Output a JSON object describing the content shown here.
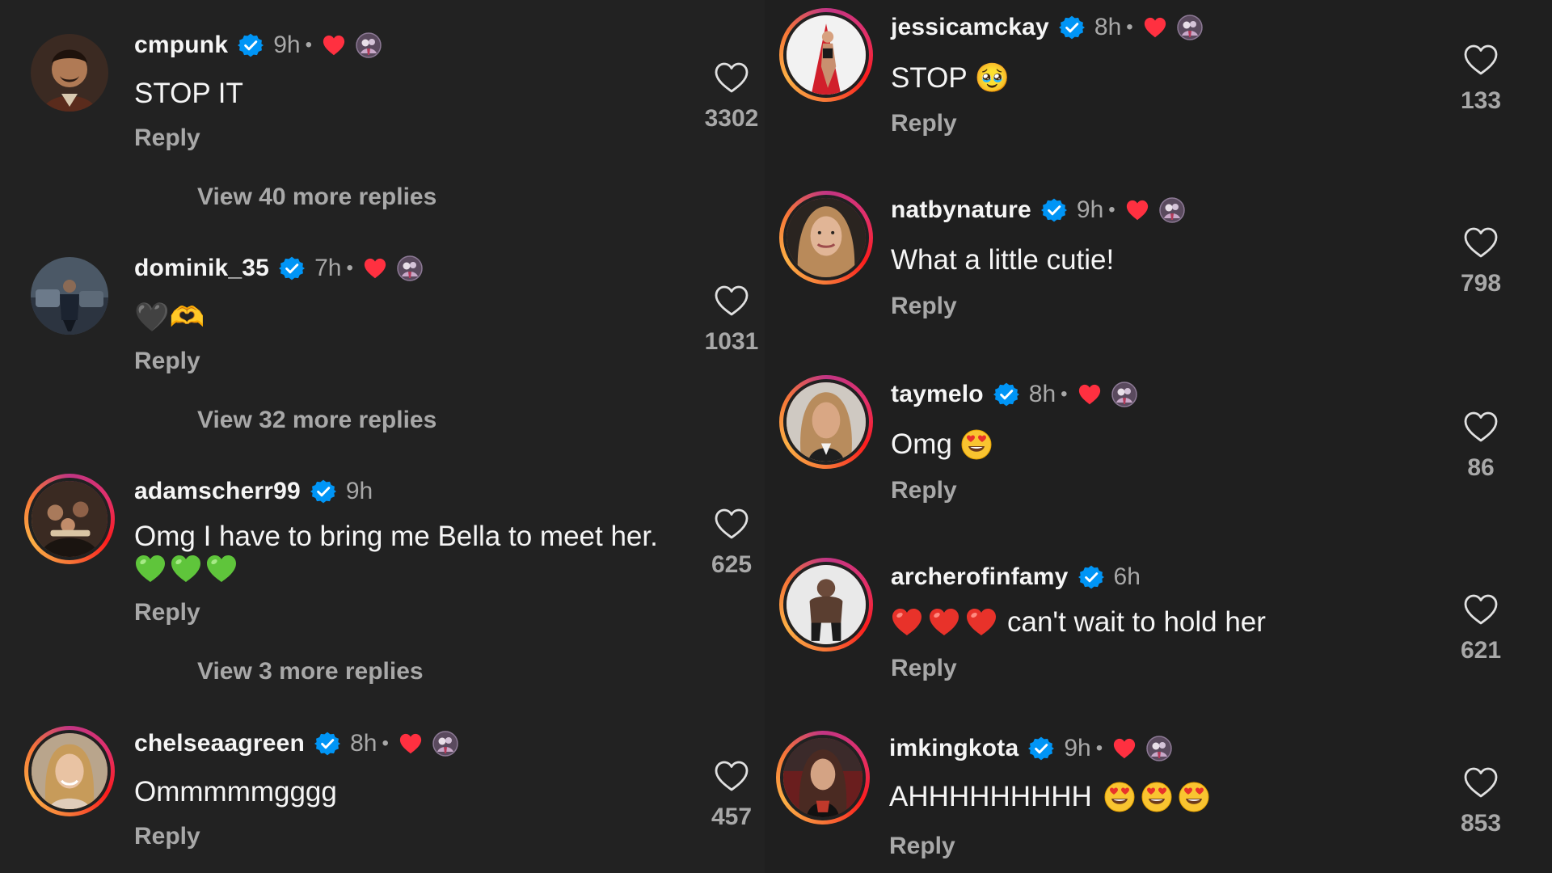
{
  "actions": {
    "reply_label": "Reply"
  },
  "colors": {
    "background": "#212121",
    "verified": "#0095f6",
    "heart": "#ff3040",
    "secondary_text": "#a8a8a8"
  },
  "icons": {
    "like": "heart-outline-icon",
    "verified": "verified-badge-icon",
    "creator_like": "red-heart-icon"
  },
  "left_comments": [
    {
      "username": "cmpunk",
      "time": "9h",
      "text": "STOP IT",
      "likes": "3302",
      "more_replies": "View 40 more replies"
    },
    {
      "username": "dominik_35",
      "time": "7h",
      "text": "🖤🫶",
      "likes": "1031",
      "more_replies": "View 32 more replies"
    },
    {
      "username": "adamscherr99",
      "time": "9h",
      "text": "Omg I have to bring me Bella to meet her.",
      "likes": "625",
      "more_replies": "View 3 more replies"
    },
    {
      "username": "chelseaagreen",
      "time": "8h",
      "text": "Ommmmmgggg",
      "likes": "457"
    }
  ],
  "right_comments": [
    {
      "username": "jessicamckay",
      "time": "8h",
      "text": "STOP 🥹",
      "likes": "133"
    },
    {
      "username": "natbynature",
      "time": "9h",
      "text": "What a little cutie!",
      "likes": "798"
    },
    {
      "username": "taymelo",
      "time": "8h",
      "text": "Omg",
      "likes": "86"
    },
    {
      "username": "archerofinfamy",
      "time": "6h",
      "text": "can't wait to hold her",
      "likes": "621"
    },
    {
      "username": "imkingkota",
      "time": "9h",
      "text": "AHHHHHHHHH",
      "likes": "853"
    }
  ]
}
